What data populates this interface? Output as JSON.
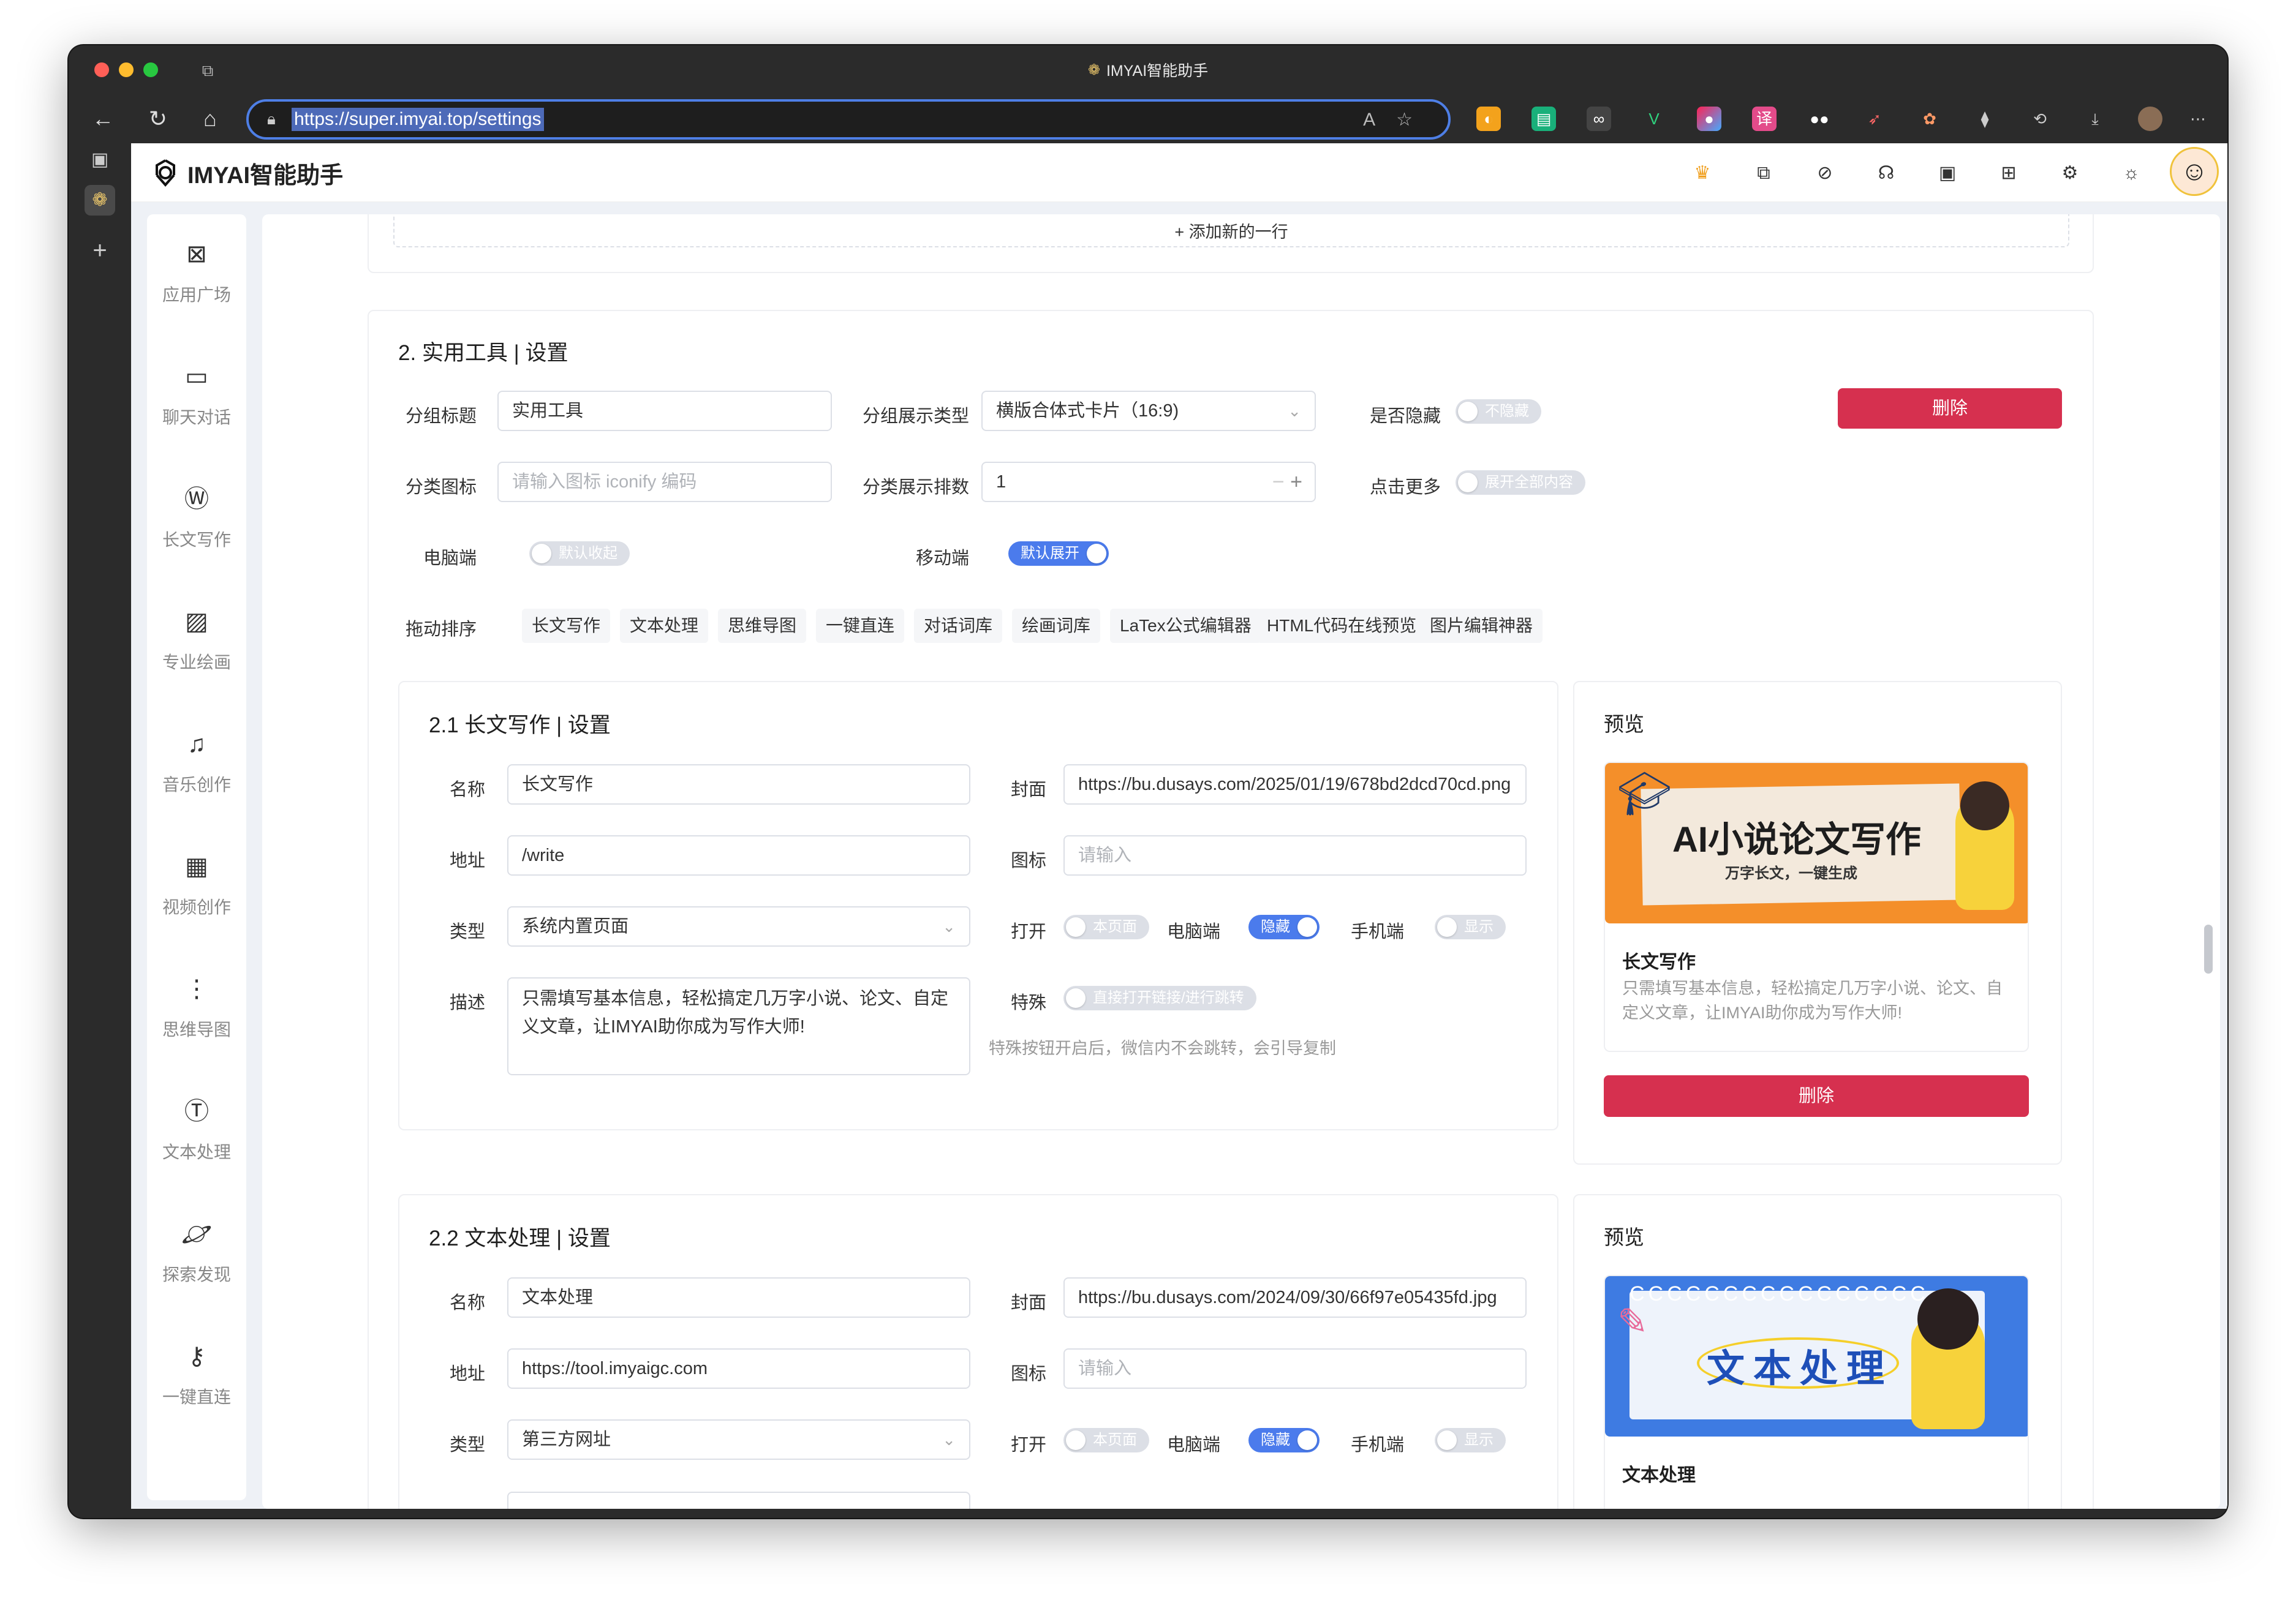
{
  "browser": {
    "title": "IMYAI智能助手",
    "url": "https://super.imyai.top/settings"
  },
  "app": {
    "brand": "IMYAI智能助手",
    "nav": [
      {
        "icon": "app-square-icon",
        "label": "应用广场"
      },
      {
        "icon": "chat-icon",
        "label": "聊天对话"
      },
      {
        "icon": "document-icon",
        "label": "长文写作"
      },
      {
        "icon": "image-icon",
        "label": "专业绘画"
      },
      {
        "icon": "music-icon",
        "label": "音乐创作"
      },
      {
        "icon": "film-icon",
        "label": "视频创作"
      },
      {
        "icon": "mindmap-icon",
        "label": "思维导图"
      },
      {
        "icon": "text-icon",
        "label": "文本处理"
      },
      {
        "icon": "planet-icon",
        "label": "探索发现"
      },
      {
        "icon": "key-icon",
        "label": "一键直连"
      }
    ]
  },
  "add_row": "+ 添加新的一行",
  "group": {
    "title": "2. 实用工具 | 设置",
    "labels": {
      "group_title": "分组标题",
      "display_type": "分组展示类型",
      "hidden": "是否隐藏",
      "icon": "分类图标",
      "sort": "分类展示排数",
      "more": "点击更多",
      "pc": "电脑端",
      "mobile": "移动端",
      "drag": "拖动排序"
    },
    "group_title_value": "实用工具",
    "display_type_value": "横版合体式卡片（16:9)",
    "hidden_switch": "不隐藏",
    "icon_placeholder": "请输入图标 iconify 编码",
    "sort_value": "1",
    "more_switch": "展开全部内容",
    "pc_switch": "默认收起",
    "mobile_switch": "默认展开",
    "delete": "删除",
    "chips": [
      "长文写作",
      "文本处理",
      "思维导图",
      "一键直连",
      "对话词库",
      "绘画词库",
      "LaTex公式编辑器",
      "HTML代码在线预览",
      "图片编辑神器"
    ]
  },
  "item_labels": {
    "name": "名称",
    "cover": "封面",
    "address": "地址",
    "icon": "图标",
    "type": "类型",
    "open": "打开",
    "pc": "电脑端",
    "mobile": "手机端",
    "desc": "描述",
    "special": "特殊",
    "icon_placeholder": "请输入",
    "sw_page": "本页面",
    "sw_hide": "隐藏",
    "sw_show": "显示",
    "sw_special": "直接打开链接/进行跳转",
    "special_hint": "特殊按钮开启后，微信内不会跳转，会引导复制",
    "preview": "预览",
    "delete": "删除"
  },
  "items": [
    {
      "title": "2.1 长文写作 | 设置",
      "name": "长文写作",
      "cover": "https://bu.dusays.com/2025/01/19/678bd2dcd70cd.png",
      "address": "/write",
      "type": "系统内置页面",
      "desc": "只需填写基本信息，轻松搞定几万字小说、论文、自定义文章，让IMYAI助你成为写作大师!",
      "cover_text": "AI小说论文写作",
      "cover_sub": "万字长文，一键生成",
      "preview_name": "长文写作",
      "preview_desc": "只需填写基本信息，轻松搞定几万字小说、论文、自定义文章，让IMYAI助你成为写作大师!"
    },
    {
      "title": "2.2 文本处理 | 设置",
      "name": "文本处理",
      "cover": "https://bu.dusays.com/2024/09/30/66f97e05435fd.jpg",
      "address": "https://tool.imyaigc.com",
      "type": "第三方网址",
      "cover_text": "文本处理",
      "preview_name": "文本处理"
    }
  ],
  "colors": {
    "accent": "#4b7bec",
    "danger": "#d6304f",
    "url_border": "#4e7fe6"
  }
}
